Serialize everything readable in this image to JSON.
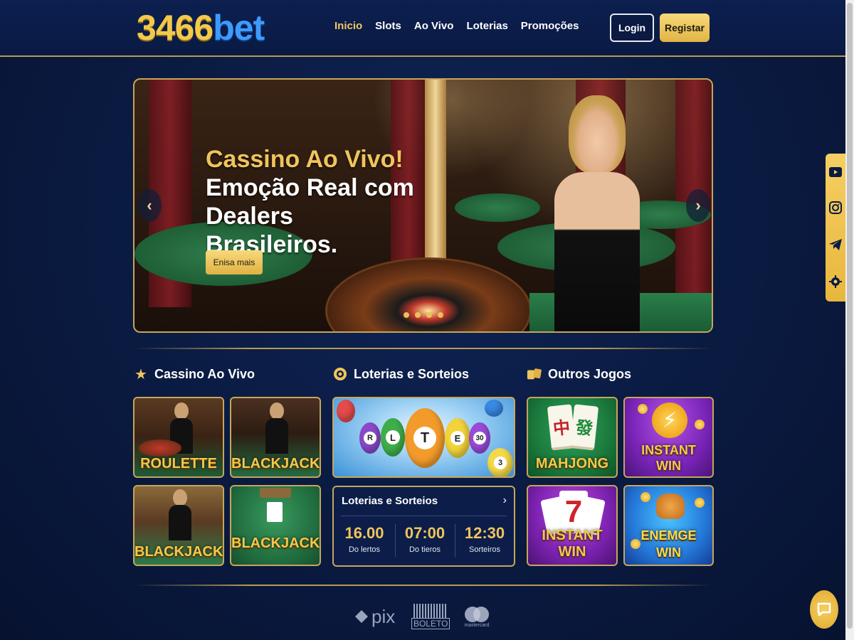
{
  "brand": {
    "logo_number": "3466",
    "logo_suffix": "bet"
  },
  "nav": {
    "items": [
      "Inicio",
      "Slots",
      "Ao Vivo",
      "Loterias",
      "Promoções"
    ],
    "active": "Inicio"
  },
  "auth": {
    "login_label": "Login",
    "register_label": "Registar"
  },
  "hero": {
    "title": "Cassino Ao Vivo!",
    "subtitle": "Emoção Real com Dealers Brasileiros.",
    "cta_label": "Enisa mais",
    "prev_arrow": "‹",
    "next_arrow": "›",
    "slide_count": 4
  },
  "sections": {
    "live_casino": {
      "title": "Cassino Ao Vivo",
      "icon": "star-icon"
    },
    "lotteries": {
      "title": "Loterias e Sorteios",
      "icon": "lottery-ball-icon"
    },
    "other_games": {
      "title": "Outros Jogos",
      "icon": "mahjong-icon"
    }
  },
  "live_casino_tiles": [
    "ROULETTE",
    "BLACKJACK",
    "BLACKJACK",
    "BLACKJACK"
  ],
  "lottery_balls": [
    "R",
    "L",
    "T",
    "E",
    "30",
    "3"
  ],
  "lottery_box": {
    "title": "Loterias e Sorteios",
    "chevron": "›",
    "columns": [
      {
        "value": "16.00",
        "caption": "Do lertos"
      },
      {
        "value": "07:00",
        "caption": "Do tieros"
      },
      {
        "value": "12:30",
        "caption": "Sorteiros"
      }
    ]
  },
  "other_games_tiles": {
    "mahjong": {
      "label": "MAHJONG",
      "glyphs": [
        "中",
        "發"
      ]
    },
    "instant_win_1": {
      "label_line1": "INSTANT",
      "label_line2": "WIN"
    },
    "instant_win_2": {
      "label": "INSTANT WIN",
      "glyph": "7"
    },
    "enemge": {
      "label_line1": "ENEMGE",
      "label_line2": "WIN"
    }
  },
  "payment_methods": {
    "pix": "pix",
    "boleto": "BOLETO",
    "mastercard": "mastercard"
  },
  "social": [
    "youtube-icon",
    "instagram-icon",
    "telegram-icon",
    "settings-icon"
  ],
  "colors": {
    "gold": "#f0c45c",
    "navy": "#0a1a43",
    "blue": "#3d9bff"
  }
}
